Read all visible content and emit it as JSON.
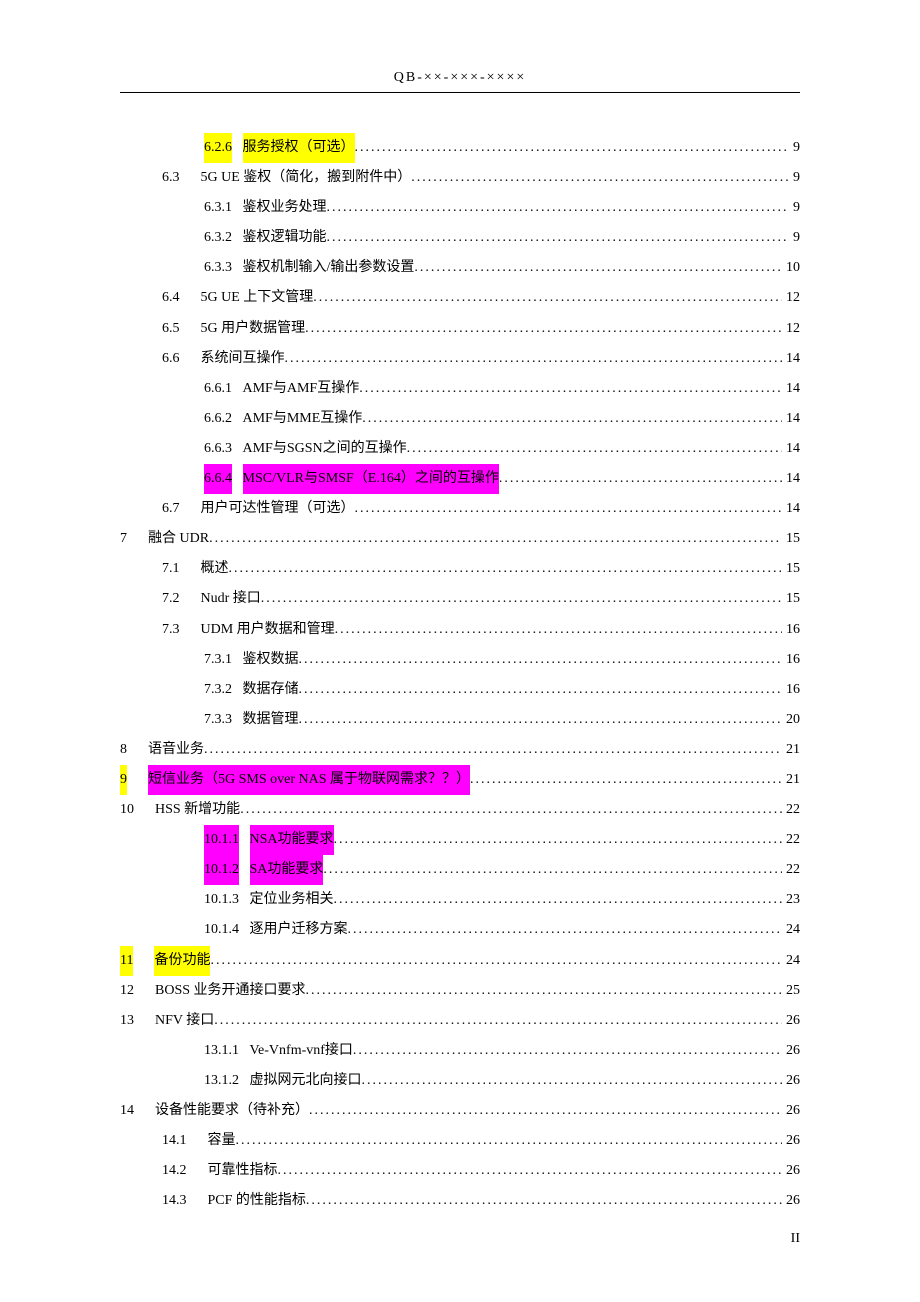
{
  "header": "QB-××-×××-××××",
  "footer_page": "II",
  "toc": [
    {
      "level": 2,
      "num": "6.2.6",
      "title": "服务授权（可选）",
      "page": "9",
      "num_hl": "yellow",
      "title_hl": "yellow"
    },
    {
      "level": 1,
      "num": "6.3",
      "title": "5G UE 鉴权（简化，搬到附件中）",
      "page": "9"
    },
    {
      "level": 2,
      "num": "6.3.1",
      "title": "鉴权业务处理",
      "page": "9"
    },
    {
      "level": 2,
      "num": "6.3.2",
      "title": "鉴权逻辑功能",
      "page": "9"
    },
    {
      "level": 2,
      "num": "6.3.3",
      "title": "鉴权机制输入/输出参数设置",
      "page": "10"
    },
    {
      "level": 1,
      "num": "6.4",
      "title": "5G UE 上下文管理",
      "page": "12"
    },
    {
      "level": 1,
      "num": "6.5",
      "title": "5G 用户数据管理",
      "page": "12"
    },
    {
      "level": 1,
      "num": "6.6",
      "title": "系统间互操作",
      "page": "14"
    },
    {
      "level": 2,
      "num": "6.6.1",
      "title": "AMF与AMF互操作",
      "page": "14"
    },
    {
      "level": 2,
      "num": "6.6.2",
      "title": "AMF与MME互操作",
      "page": "14"
    },
    {
      "level": 2,
      "num": "6.6.3",
      "title": "AMF与SGSN之间的互操作",
      "page": "14"
    },
    {
      "level": 2,
      "num": "6.6.4",
      "title": "MSC/VLR与SMSF（E.164）之间的互操作",
      "page": "14",
      "num_hl": "magenta",
      "title_hl": "magenta"
    },
    {
      "level": 1,
      "num": "6.7",
      "title": "用户可达性管理（可选）",
      "page": "14"
    },
    {
      "level": 0,
      "num": "7",
      "title": "融合 UDR",
      "page": "15"
    },
    {
      "level": 1,
      "num": "7.1",
      "title": "概述",
      "page": "15"
    },
    {
      "level": 1,
      "num": "7.2",
      "title": "Nudr 接口",
      "page": "15"
    },
    {
      "level": 1,
      "num": "7.3",
      "title": "UDM 用户数据和管理",
      "page": "16"
    },
    {
      "level": 2,
      "num": "7.3.1",
      "title": "鉴权数据",
      "page": "16"
    },
    {
      "level": 2,
      "num": "7.3.2",
      "title": "数据存储",
      "page": "16"
    },
    {
      "level": 2,
      "num": "7.3.3",
      "title": "数据管理",
      "page": "20"
    },
    {
      "level": 0,
      "num": "8",
      "title": "语音业务",
      "page": "21"
    },
    {
      "level": 0,
      "num": "9",
      "title": "短信业务（5G SMS over NAS 属于物联网需求？？）",
      "page": "21",
      "num_hl": "yellow",
      "title_hl": "magenta"
    },
    {
      "level": 0,
      "num": "10",
      "title": "HSS 新增功能",
      "page": "22"
    },
    {
      "level": 2,
      "num": "10.1.1",
      "title": "NSA功能要求",
      "page": "22",
      "num_hl": "magenta",
      "title_hl": "magenta"
    },
    {
      "level": 2,
      "num": "10.1.2",
      "title": "SA功能要求",
      "page": "22",
      "num_hl": "magenta",
      "title_hl": "magenta"
    },
    {
      "level": 2,
      "num": "10.1.3",
      "title": "定位业务相关",
      "page": "23"
    },
    {
      "level": 2,
      "num": "10.1.4",
      "title": "逐用户迁移方案",
      "page": "24"
    },
    {
      "level": 0,
      "num": "11",
      "title": "备份功能",
      "page": "24",
      "num_hl": "yellow",
      "title_hl": "yellow"
    },
    {
      "level": 0,
      "num": "12",
      "title": "BOSS 业务开通接口要求",
      "page": "25"
    },
    {
      "level": 0,
      "num": "13",
      "title": "NFV 接口",
      "page": "26"
    },
    {
      "level": 2,
      "num": "13.1.1",
      "title": "Ve-Vnfm-vnf接口",
      "page": "26"
    },
    {
      "level": 2,
      "num": "13.1.2",
      "title": "虚拟网元北向接口",
      "page": "26"
    },
    {
      "level": 0,
      "num": "14",
      "title": "设备性能要求（待补充）",
      "page": "26"
    },
    {
      "level": 1,
      "num": "14.1",
      "title": "容量",
      "page": "26"
    },
    {
      "level": 1,
      "num": "14.2",
      "title": "可靠性指标",
      "page": "26"
    },
    {
      "level": 1,
      "num": "14.3",
      "title": "PCF 的性能指标",
      "page": "26"
    }
  ]
}
